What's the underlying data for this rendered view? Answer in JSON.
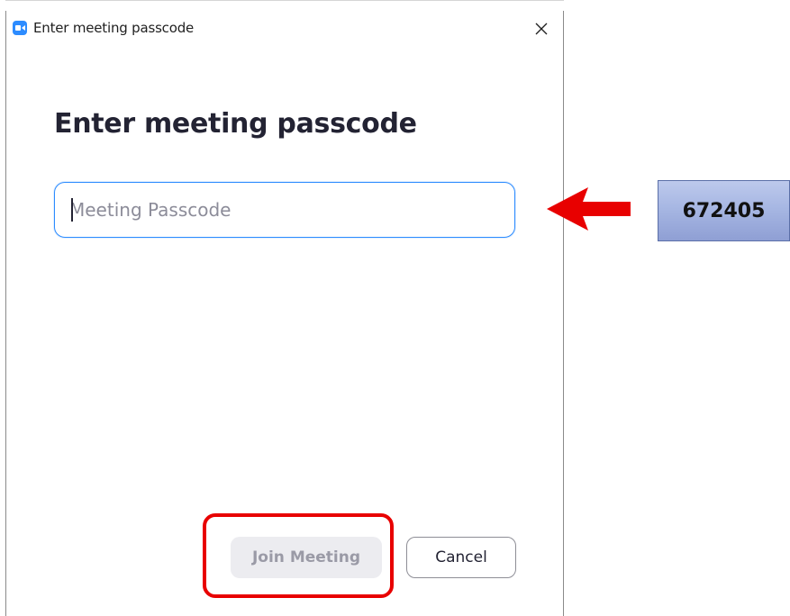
{
  "window": {
    "title": "Enter meeting passcode"
  },
  "dialog": {
    "heading": "Enter meeting passcode",
    "passcode_input": {
      "value": "",
      "placeholder": "Meeting Passcode"
    },
    "join_button_label": "Join Meeting",
    "cancel_button_label": "Cancel"
  },
  "annotation": {
    "passcode_value": "672405"
  },
  "icons": {
    "app": "zoom-camera-icon",
    "close": "close-icon",
    "arrow": "red-arrow-left-icon"
  },
  "colors": {
    "accent": "#2d8cff",
    "highlight": "#e80000",
    "callout": "#a7b7e3"
  }
}
